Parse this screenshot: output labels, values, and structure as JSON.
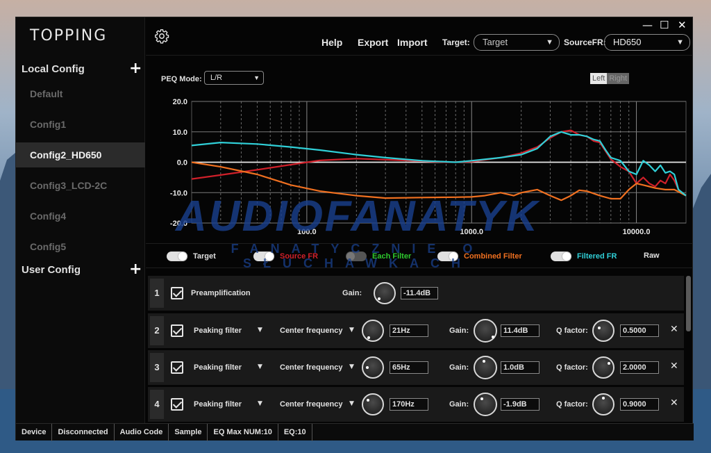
{
  "app": {
    "logo": "TOPPING"
  },
  "window_controls": {
    "minimize": "—",
    "maximize": "☐",
    "close": "✕"
  },
  "sidebar": {
    "local_config_label": "Local Config",
    "user_config_label": "User Config",
    "add_symbol": "+",
    "items": [
      {
        "label": "Default",
        "active": false
      },
      {
        "label": "Config1",
        "active": false
      },
      {
        "label": "Config2_HD650",
        "active": true
      },
      {
        "label": "Config3_LCD-2C",
        "active": false
      },
      {
        "label": "Config4",
        "active": false
      },
      {
        "label": "Config5",
        "active": false
      }
    ]
  },
  "toolbar": {
    "help": "Help",
    "export": "Export",
    "import": "Import",
    "target_label": "Target:",
    "target_value": "Target",
    "source_label": "SourceFR:",
    "source_value": "HD650"
  },
  "graph": {
    "peq_mode_label": "PEQ Mode:",
    "peq_mode_value": "L/R",
    "channel_left": "Left",
    "channel_right": "Right"
  },
  "watermark": {
    "main": "AUDIOFANATYK",
    "sub": "FANATYCZNIE O SŁUCHAWKACH"
  },
  "legend": [
    {
      "label": "Target",
      "color": "#e0e0e0",
      "on": true
    },
    {
      "label": "Source FR",
      "color": "#d0202a",
      "on": true
    },
    {
      "label": "Each Filter",
      "color": "#2ec92e",
      "on": false
    },
    {
      "label": "Combined Filter",
      "color": "#f07020",
      "on": true
    },
    {
      "label": "Filtered FR",
      "color": "#30d0d8",
      "on": true
    },
    {
      "label": "Raw",
      "color": "#e0e0e0",
      "on": null
    }
  ],
  "filters": [
    {
      "index": "1",
      "type": "Preamplification",
      "gain_label": "Gain:",
      "gain": "-11.4dB"
    },
    {
      "index": "2",
      "type": "Peaking filter",
      "freq_label": "Center frequency",
      "freq": "21Hz",
      "gain_label": "Gain:",
      "gain": "11.4dB",
      "q_label": "Q factor:",
      "q": "0.5000"
    },
    {
      "index": "3",
      "type": "Peaking filter",
      "freq_label": "Center frequency",
      "freq": "65Hz",
      "gain_label": "Gain:",
      "gain": "1.0dB",
      "q_label": "Q factor:",
      "q": "2.0000"
    },
    {
      "index": "4",
      "type": "Peaking filter",
      "freq_label": "Center frequency",
      "freq": "170Hz",
      "gain_label": "Gain:",
      "gain": "-1.9dB",
      "q_label": "Q factor:",
      "q": "0.9000"
    }
  ],
  "statusbar": [
    "Device",
    "Disconnected",
    "Audio Code",
    "Sample",
    "EQ Max NUM:10",
    "EQ:10"
  ],
  "chart_data": {
    "type": "line",
    "title": "",
    "xlabel": "",
    "ylabel": "",
    "xscale": "log",
    "xlim": [
      20,
      20000
    ],
    "ylim": [
      -20,
      20
    ],
    "x_tick_labels": [
      "100.0",
      "1000.0",
      "10000.0"
    ],
    "x_ticks": [
      100,
      1000,
      10000
    ],
    "y_tick_labels": [
      "20.0",
      "10.0",
      "0.0",
      "-10.0",
      "-20.0"
    ],
    "y_ticks": [
      20,
      10,
      0,
      -10,
      -20
    ],
    "grid": true,
    "series": [
      {
        "key": "target",
        "color": "#e8e8e8",
        "points": [
          [
            20,
            0
          ],
          [
            20000,
            0
          ]
        ]
      },
      {
        "key": "source",
        "color": "#d0202a",
        "points": [
          [
            20,
            -5.5
          ],
          [
            30,
            -4.2
          ],
          [
            50,
            -2.5
          ],
          [
            80,
            -0.8
          ],
          [
            120,
            0.6
          ],
          [
            200,
            1.2
          ],
          [
            400,
            0.6
          ],
          [
            700,
            0
          ],
          [
            1000,
            0.2
          ],
          [
            1500,
            1.5
          ],
          [
            2000,
            3
          ],
          [
            2500,
            5
          ],
          [
            3000,
            8
          ],
          [
            3500,
            10
          ],
          [
            4000,
            10.5
          ],
          [
            4500,
            9
          ],
          [
            5000,
            8.5
          ],
          [
            5500,
            7
          ],
          [
            6000,
            6.5
          ],
          [
            7000,
            1
          ],
          [
            8000,
            -1.5
          ],
          [
            9000,
            -3
          ],
          [
            10000,
            -7
          ],
          [
            11000,
            -5
          ],
          [
            12000,
            -7
          ],
          [
            13000,
            -8
          ],
          [
            14000,
            -6
          ],
          [
            15000,
            -7
          ],
          [
            16000,
            -4
          ],
          [
            17000,
            -6
          ],
          [
            18000,
            -9
          ],
          [
            20000,
            -11
          ]
        ]
      },
      {
        "key": "combined",
        "color": "#f07020",
        "points": [
          [
            20,
            0
          ],
          [
            30,
            -1.5
          ],
          [
            50,
            -4
          ],
          [
            80,
            -7.5
          ],
          [
            120,
            -9.5
          ],
          [
            200,
            -11
          ],
          [
            300,
            -11.8
          ],
          [
            500,
            -11.6
          ],
          [
            800,
            -11.5
          ],
          [
            1000,
            -11.4
          ],
          [
            1200,
            -11
          ],
          [
            1500,
            -10
          ],
          [
            1800,
            -11
          ],
          [
            2000,
            -10
          ],
          [
            2500,
            -9
          ],
          [
            3000,
            -11
          ],
          [
            3500,
            -12.5
          ],
          [
            4000,
            -11
          ],
          [
            4500,
            -9.2
          ],
          [
            5000,
            -9.5
          ],
          [
            6000,
            -11
          ],
          [
            7000,
            -12
          ],
          [
            8000,
            -12
          ],
          [
            9000,
            -9
          ],
          [
            10000,
            -7
          ],
          [
            11000,
            -7.5
          ],
          [
            12000,
            -8
          ],
          [
            13000,
            -8.5
          ],
          [
            15000,
            -9
          ],
          [
            17000,
            -9
          ],
          [
            20000,
            -11
          ]
        ]
      },
      {
        "key": "filtered",
        "color": "#30d0d8",
        "points": [
          [
            20,
            5.5
          ],
          [
            30,
            6.5
          ],
          [
            50,
            6
          ],
          [
            80,
            5
          ],
          [
            120,
            4
          ],
          [
            200,
            2.5
          ],
          [
            300,
            1.5
          ],
          [
            500,
            0.5
          ],
          [
            800,
            0
          ],
          [
            1000,
            0.5
          ],
          [
            1500,
            1.5
          ],
          [
            2000,
            2.5
          ],
          [
            2500,
            4.5
          ],
          [
            3000,
            8.5
          ],
          [
            3500,
            10
          ],
          [
            4000,
            9
          ],
          [
            4500,
            9
          ],
          [
            5000,
            8.5
          ],
          [
            5500,
            7.5
          ],
          [
            6000,
            7
          ],
          [
            6500,
            4
          ],
          [
            7000,
            1.5
          ],
          [
            8000,
            0.5
          ],
          [
            9000,
            -3
          ],
          [
            10000,
            -4
          ],
          [
            11000,
            0.5
          ],
          [
            12000,
            -1
          ],
          [
            13000,
            -3
          ],
          [
            14000,
            -1
          ],
          [
            15000,
            -3.5
          ],
          [
            16000,
            -3
          ],
          [
            17000,
            -4
          ],
          [
            18000,
            -9
          ],
          [
            20000,
            -11
          ]
        ]
      }
    ]
  }
}
